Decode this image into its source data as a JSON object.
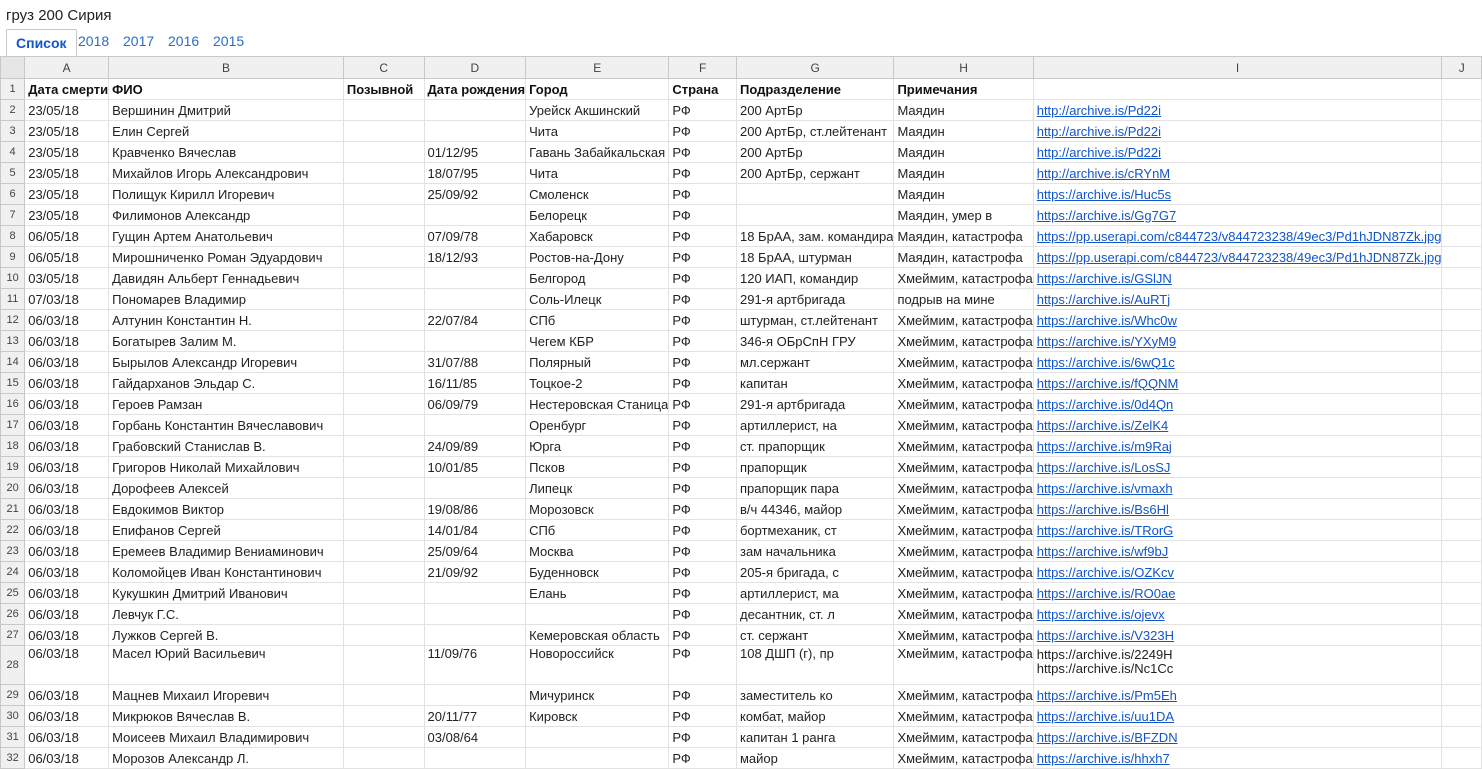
{
  "document": {
    "title": "груз 200 Сирия"
  },
  "tabs": [
    {
      "label": "Список",
      "active": true
    },
    {
      "label": "2018",
      "active": false
    },
    {
      "label": "2017",
      "active": false
    },
    {
      "label": "2016",
      "active": false
    },
    {
      "label": "2015",
      "active": false
    }
  ],
  "columns": [
    "A",
    "B",
    "C",
    "D",
    "E",
    "F",
    "G",
    "H",
    "I",
    "J"
  ],
  "headers": [
    "Дата смерти",
    "ФИО",
    "Позывной",
    "Дата рождения",
    "Город",
    "Страна",
    "Подразделение",
    "Примечания",
    "",
    ""
  ],
  "rows": [
    {
      "n": "2",
      "date": "23/05/18",
      "name": "Вершинин Дмитрий",
      "call": "",
      "born": "",
      "city": "Урейск Акшинский",
      "country": "РФ",
      "unit": "200 АртБр",
      "notes": "Маядин",
      "link": "http://archive.is/Pd22i"
    },
    {
      "n": "3",
      "date": "23/05/18",
      "name": "Елин Сергей",
      "call": "",
      "born": "",
      "city": "Чита",
      "country": "РФ",
      "unit": "200 АртБр, ст.лейтенант",
      "notes": "Маядин",
      "link": "http://archive.is/Pd22i"
    },
    {
      "n": "4",
      "date": "23/05/18",
      "name": "Кравченко Вячеслав",
      "call": "",
      "born": "01/12/95",
      "city": "Гавань Забайкальская",
      "country": "РФ",
      "unit": "200 АртБр",
      "notes": "Маядин",
      "link": "http://archive.is/Pd22i"
    },
    {
      "n": "5",
      "date": "23/05/18",
      "name": "Михайлов Игорь Александрович",
      "call": "",
      "born": "18/07/95",
      "city": "Чита",
      "country": "РФ",
      "unit": "200 АртБр, сержант",
      "notes": "Маядин",
      "link": "http://archive.is/cRYnM"
    },
    {
      "n": "6",
      "date": "23/05/18",
      "name": "Полищук Кирилл Игоревич",
      "call": "",
      "born": "25/09/92",
      "city": "Смоленск",
      "country": "РФ",
      "unit": "",
      "notes": "Маядин",
      "link": "https://archive.is/Huc5s"
    },
    {
      "n": "7",
      "date": "23/05/18",
      "name": "Филимонов Александр",
      "call": "",
      "born": "",
      "city": "Белорецк",
      "country": "РФ",
      "unit": "",
      "notes": "Маядин, умер в",
      "link": "https://archive.is/Gg7G7"
    },
    {
      "n": "8",
      "date": "06/05/18",
      "name": "Гущин Артем Анатольевич",
      "call": "",
      "born": "07/09/78",
      "city": "Хабаровск",
      "country": "РФ",
      "unit": "18 БрАА, зам. командира",
      "notes": "Маядин, катастрофа",
      "link": "https://pp.userapi.com/c844723/v844723238/49ec3/Pd1hJDN87Zk.jpg"
    },
    {
      "n": "9",
      "date": "06/05/18",
      "name": "Мирошниченко Роман Эдуардович",
      "call": "",
      "born": "18/12/93",
      "city": "Ростов-на-Дону",
      "country": "РФ",
      "unit": "18 БрАА, штурман",
      "notes": "Маядин, катастрофа",
      "link": "https://pp.userapi.com/c844723/v844723238/49ec3/Pd1hJDN87Zk.jpg"
    },
    {
      "n": "10",
      "date": "03/05/18",
      "name": "Давидян Альберт Геннадьевич",
      "call": "",
      "born": "",
      "city": "Белгород",
      "country": "РФ",
      "unit": "120 ИАП, командир",
      "notes": "Хмеймим, катастрофа",
      "link": "https://archive.is/GSlJN"
    },
    {
      "n": "11",
      "date": "07/03/18",
      "name": "Пономарев Владимир",
      "call": "",
      "born": "",
      "city": "Соль-Илецк",
      "country": "РФ",
      "unit": "291-я артбригада",
      "notes": "подрыв на мине",
      "link": "https://archive.is/AuRTj"
    },
    {
      "n": "12",
      "date": "06/03/18",
      "name": "Алтунин Константин Н.",
      "call": "",
      "born": "22/07/84",
      "city": "СПб",
      "country": "РФ",
      "unit": "штурман, ст.лейтенант",
      "notes": "Хмеймим, катастрофа",
      "link": "https://archive.is/Whc0w"
    },
    {
      "n": "13",
      "date": "06/03/18",
      "name": "Богатырев Залим М.",
      "call": "",
      "born": "",
      "city": "Чегем КБР",
      "country": "РФ",
      "unit": "346-я ОБрСпН ГРУ",
      "notes": "Хмеймим, катастрофа",
      "link": "https://archive.is/YXyM9"
    },
    {
      "n": "14",
      "date": "06/03/18",
      "name": "Бырылов Александр Игоревич",
      "call": "",
      "born": "31/07/88",
      "city": "Полярный",
      "country": "РФ",
      "unit": "мл.сержант",
      "notes": "Хмеймим, катастрофа",
      "link": "https://archive.is/6wQ1c"
    },
    {
      "n": "15",
      "date": "06/03/18",
      "name": "Гайдарханов Эльдар С.",
      "call": "",
      "born": "16/11/85",
      "city": "Тоцкое-2",
      "country": "РФ",
      "unit": "капитан",
      "notes": "Хмеймим, катастрофа",
      "link": "https://archive.is/fQQNM"
    },
    {
      "n": "16",
      "date": "06/03/18",
      "name": "Героев Рамзан",
      "call": "",
      "born": "06/09/79",
      "city": "Нестеровская Станица",
      "country": "РФ",
      "unit": "291-я артбригада",
      "notes": "Хмеймим, катастрофа",
      "link": "https://archive.is/0d4Qn"
    },
    {
      "n": "17",
      "date": "06/03/18",
      "name": "Горбань Константин Вячеславович",
      "call": "",
      "born": "",
      "city": "Оренбург",
      "country": "РФ",
      "unit": "артиллерист, на",
      "notes": "Хмеймим, катастрофа",
      "link": "https://archive.is/ZelK4"
    },
    {
      "n": "18",
      "date": "06/03/18",
      "name": "Грабовский Станислав В.",
      "call": "",
      "born": "24/09/89",
      "city": "Юрга",
      "country": "РФ",
      "unit": "ст. прапорщик",
      "notes": "Хмеймим, катастрофа",
      "link": "https://archive.is/m9Raj"
    },
    {
      "n": "19",
      "date": "06/03/18",
      "name": "Григоров Николай Михайлович",
      "call": "",
      "born": "10/01/85",
      "city": "Псков",
      "country": "РФ",
      "unit": "прапорщик",
      "notes": "Хмеймим, катастрофа",
      "link": "https://archive.is/LosSJ"
    },
    {
      "n": "20",
      "date": "06/03/18",
      "name": "Дорофеев Алексей",
      "call": "",
      "born": "",
      "city": "Липецк",
      "country": "РФ",
      "unit": "прапорщик пара",
      "notes": "Хмеймим, катастрофа",
      "link": "https://archive.is/vmaxh"
    },
    {
      "n": "21",
      "date": "06/03/18",
      "name": "Евдокимов Виктор",
      "call": "",
      "born": "19/08/86",
      "city": "Морозовск",
      "country": "РФ",
      "unit": "в/ч 44346, майор",
      "notes": "Хмеймим, катастрофа",
      "link": "https://archive.is/Bs6Hl"
    },
    {
      "n": "22",
      "date": "06/03/18",
      "name": "Епифанов Сергей",
      "call": "",
      "born": "14/01/84",
      "city": "СПб",
      "country": "РФ",
      "unit": "бортмеханик, ст",
      "notes": "Хмеймим, катастрофа",
      "link": "https://archive.is/TRorG"
    },
    {
      "n": "23",
      "date": "06/03/18",
      "name": "Еремеев Владимир Вениаминович",
      "call": "",
      "born": "25/09/64",
      "city": "Москва",
      "country": "РФ",
      "unit": "зам начальника",
      "notes": "Хмеймим, катастрофа",
      "link": "https://archive.is/wf9bJ"
    },
    {
      "n": "24",
      "date": "06/03/18",
      "name": "Коломойцев Иван Константинович",
      "call": "",
      "born": "21/09/92",
      "city": "Буденновск",
      "country": "РФ",
      "unit": "205-я бригада, с",
      "notes": "Хмеймим, катастрофа",
      "link": "https://archive.is/OZKcv"
    },
    {
      "n": "25",
      "date": "06/03/18",
      "name": "Кукушкин Дмитрий Иванович",
      "call": "",
      "born": "",
      "city": "Елань",
      "country": "РФ",
      "unit": "артиллерист, ма",
      "notes": "Хмеймим, катастрофа",
      "link": "https://archive.is/RO0ae"
    },
    {
      "n": "26",
      "date": "06/03/18",
      "name": "Левчук Г.С.",
      "call": "",
      "born": "",
      "city": "",
      "country": "РФ",
      "unit": "десантник, ст. л",
      "notes": "Хмеймим, катастрофа",
      "link": "https://archive.is/ojevx"
    },
    {
      "n": "27",
      "date": "06/03/18",
      "name": "Лужков Сергей В.",
      "call": "",
      "born": "",
      "city": "Кемеровская область",
      "country": "РФ",
      "unit": "ст. сержант",
      "notes": "Хмеймим, катастрофа",
      "link": "https://archive.is/V323H"
    },
    {
      "n": "28",
      "date": "06/03/18",
      "name": "Масел Юрий Васильевич",
      "call": "",
      "born": "11/09/76",
      "city": "Новороссийск",
      "country": "РФ",
      "unit": "108 ДШП (г), пр",
      "notes": "Хмеймим, катастрофа",
      "link": "https://archive.is/2249H\nhttps://archive.is/Nc1Cc",
      "tall": true
    },
    {
      "n": "29",
      "date": "06/03/18",
      "name": "Мацнев Михаил Игоревич",
      "call": "",
      "born": "",
      "city": "Мичуринск",
      "country": "РФ",
      "unit": "заместитель ко",
      "notes": "Хмеймим, катастрофа",
      "link": "https://archive.is/Pm5Eh"
    },
    {
      "n": "30",
      "date": "06/03/18",
      "name": "Микрюков Вячеслав В.",
      "call": "",
      "born": "20/11/77",
      "city": "Кировск",
      "country": "РФ",
      "unit": "комбат, майор",
      "notes": "Хмеймим, катастрофа",
      "link": "https://archive.is/uu1DA"
    },
    {
      "n": "31",
      "date": "06/03/18",
      "name": "Моисеев Михаил Владимирович",
      "call": "",
      "born": "03/08/64",
      "city": "",
      "country": "РФ",
      "unit": "капитан 1 ранга",
      "notes": "Хмеймим, катастрофа",
      "link": "https://archive.is/BFZDN"
    },
    {
      "n": "32",
      "date": "06/03/18",
      "name": "Морозов Александр Л.",
      "call": "",
      "born": "",
      "city": "",
      "country": "РФ",
      "unit": "майор",
      "notes": "Хмеймим, катастрофа",
      "link": "https://archive.is/hhxh7"
    }
  ]
}
